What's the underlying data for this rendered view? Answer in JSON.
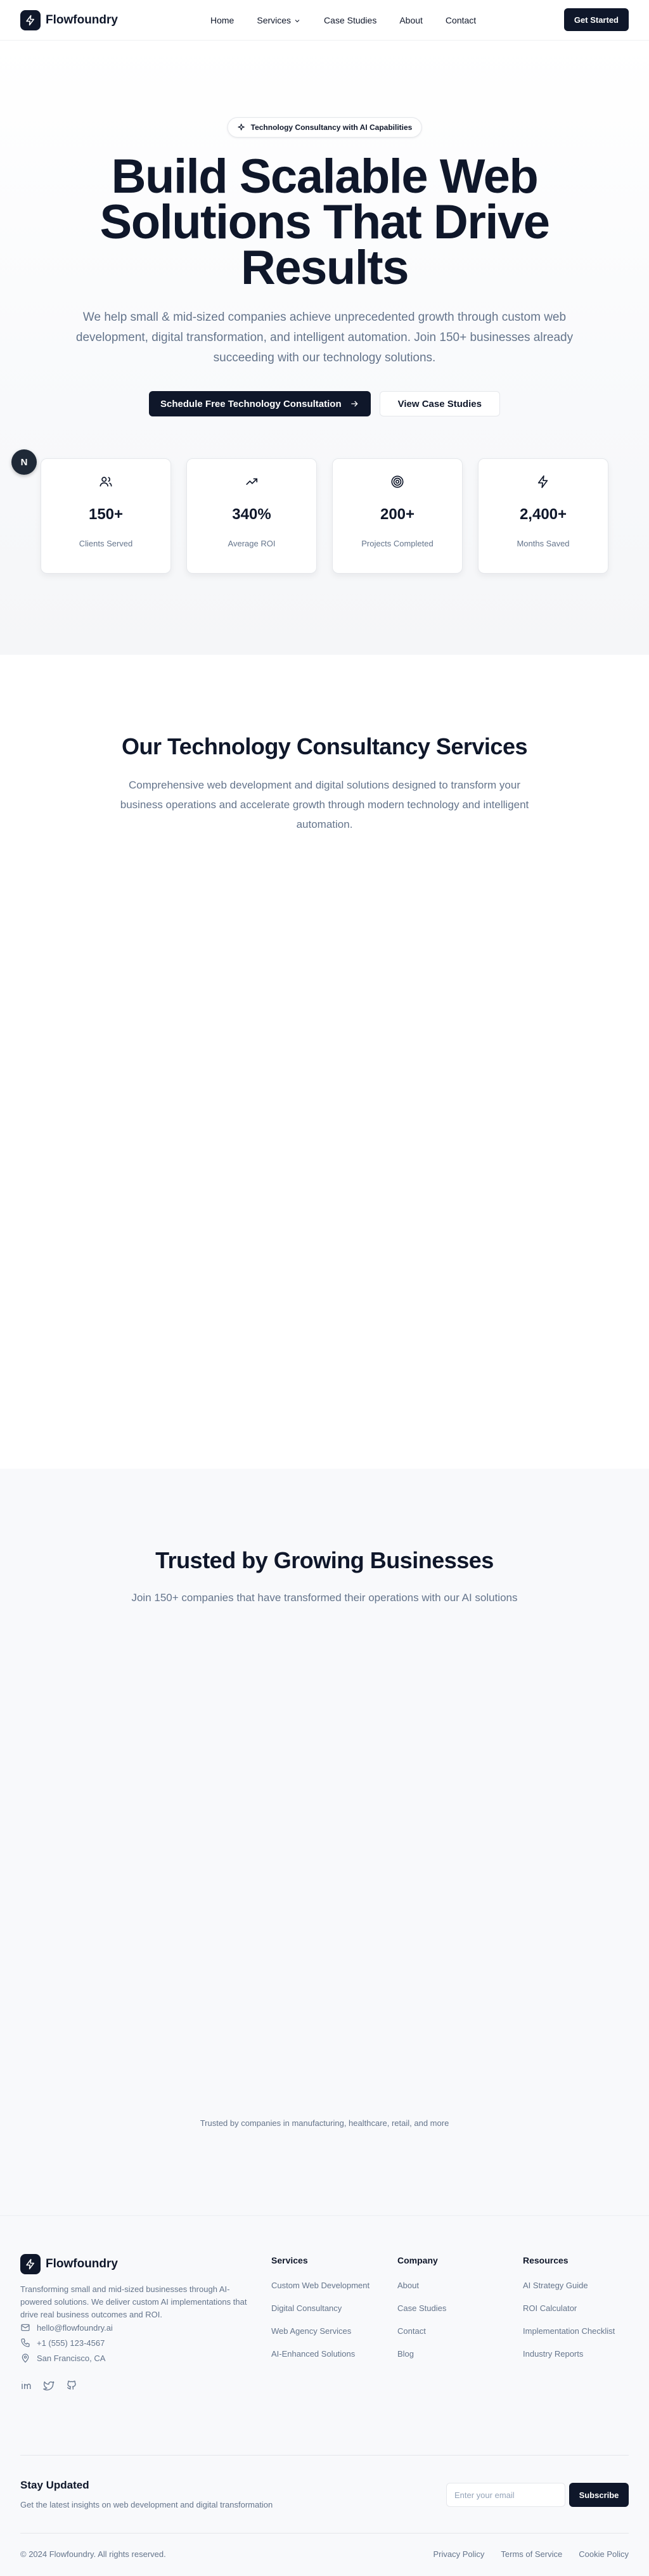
{
  "header": {
    "brand": "Flowfoundry",
    "nav": [
      {
        "label": "Home"
      },
      {
        "label": "Services"
      },
      {
        "label": "Case Studies"
      },
      {
        "label": "About"
      },
      {
        "label": "Contact"
      }
    ],
    "cta": "Get Started"
  },
  "hero": {
    "badge": "Technology Consultancy with AI Capabilities",
    "title": "Build Scalable Web Solutions That Drive Results",
    "subtitle": "We help small & mid-sized companies achieve unprecedented growth through custom web development, digital transformation, and intelligent automation. Join 150+ businesses already succeeding with our technology solutions.",
    "primary_cta": "Schedule Free Technology Consultation",
    "secondary_cta": "View Case Studies",
    "side_button": "N",
    "stats": [
      {
        "value": "150+",
        "label": "Clients Served",
        "icon": "users-icon"
      },
      {
        "value": "340%",
        "label": "Average ROI",
        "icon": "trending-up-icon"
      },
      {
        "value": "200+",
        "label": "Projects Completed",
        "icon": "target-icon"
      },
      {
        "value": "2,400+",
        "label": "Months Saved",
        "icon": "lightning-icon"
      }
    ]
  },
  "services": {
    "title": "Our Technology Consultancy Services",
    "subtitle": "Comprehensive web development and digital solutions designed to transform your business operations and accelerate growth through modern technology and intelligent automation."
  },
  "trusted": {
    "title": "Trusted by Growing Businesses",
    "subtitle": "Join 150+ companies that have transformed their operations with our AI solutions",
    "note": "Trusted by companies in manufacturing, healthcare, retail, and more"
  },
  "footer": {
    "brand": "Flowfoundry",
    "description": "Transforming small and mid-sized businesses through AI-powered solutions. We deliver custom AI implementations that drive real business outcomes and ROI.",
    "email": "hello@flowfoundry.ai",
    "phone": "+1 (555) 123-4567",
    "location": "San Francisco, CA",
    "columns": [
      {
        "title": "Services",
        "links": [
          "Custom Web Development",
          "Digital Consultancy",
          "Web Agency Services",
          "AI-Enhanced Solutions"
        ]
      },
      {
        "title": "Company",
        "links": [
          "About",
          "Case Studies",
          "Contact",
          "Blog"
        ]
      },
      {
        "title": "Resources",
        "links": [
          "AI Strategy Guide",
          "ROI Calculator",
          "Implementation Checklist",
          "Industry Reports"
        ]
      }
    ],
    "newsletter": {
      "title": "Stay Updated",
      "subtitle": "Get the latest insights on web development and digital transformation",
      "placeholder": "Enter your email",
      "button": "Subscribe"
    },
    "copyright": "© 2024 Flowfoundry. All rights reserved.",
    "legal": [
      "Privacy Policy",
      "Terms of Service",
      "Cookie Policy"
    ]
  },
  "colors": {
    "primary": "#0f172a",
    "muted_text": "#64748b",
    "section_bg": "#f8f9fb"
  }
}
